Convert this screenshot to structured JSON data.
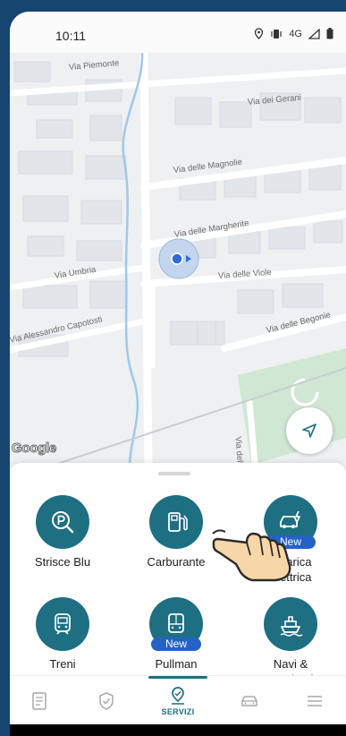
{
  "status_bar": {
    "time": "10:11",
    "network": "4G"
  },
  "map": {
    "provider_logo": "Google",
    "streets": {
      "via_piemonte": "Via Piemonte",
      "via_dei_gerani": "Via dei Gerani",
      "via_delle_magnolie": "Via delle Magnolie",
      "via_delle_margherite": "Via delle Margherite",
      "via_umbria": "Via Umbria",
      "via_delle_viole": "Via delle Viole",
      "via_alessandro_capotosti": "Via Alessandro Capotosti",
      "via_delle_begonie": "Via delle Begonie",
      "via_delle_partial": "Via delle"
    },
    "locate_button_icon": "navigation-arrow-icon"
  },
  "services": [
    {
      "label": "Strisce Blu",
      "icon": "parking-search-icon",
      "badge": ""
    },
    {
      "label": "Carburante",
      "icon": "fuel-pump-icon",
      "badge": ""
    },
    {
      "label": "Ricarica\nElettrica",
      "icon": "electric-car-icon",
      "badge": "New"
    },
    {
      "label": "Treni",
      "icon": "train-icon",
      "badge": ""
    },
    {
      "label": "Pullman",
      "icon": "bus-icon",
      "badge": "New"
    },
    {
      "label": "Navi &\nTraghetti",
      "icon": "ship-icon",
      "badge": ""
    }
  ],
  "nav": {
    "active_label": "SERVIZI",
    "items": [
      "document-icon",
      "shield-icon",
      "servizi-icon",
      "car-icon",
      "menu-icon"
    ]
  },
  "colors": {
    "accent": "#1e6f82",
    "badge": "#2463c5",
    "frame": "#16466f"
  }
}
